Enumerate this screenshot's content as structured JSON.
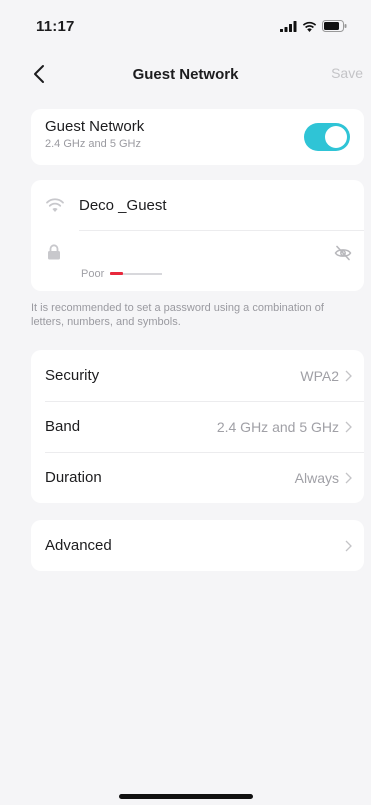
{
  "status": {
    "time": "11:17"
  },
  "nav": {
    "title": "Guest Network",
    "save": "Save"
  },
  "guest": {
    "title": "Guest Network",
    "subtitle": "2.4 GHz and 5 GHz",
    "enabled": true
  },
  "credentials": {
    "ssid": "Deco _Guest",
    "password": "",
    "strength_label": "Poor",
    "strength_level": 0.25
  },
  "hint": "It is recommended to set a password using a combination of letters, numbers, and symbols.",
  "settings": [
    {
      "label": "Security",
      "value": "WPA2"
    },
    {
      "label": "Band",
      "value": "2.4 GHz and 5 GHz"
    },
    {
      "label": "Duration",
      "value": "Always"
    }
  ],
  "advanced": {
    "label": "Advanced"
  },
  "colors": {
    "accent": "#2fc4d6",
    "weak": "#e8283c"
  }
}
